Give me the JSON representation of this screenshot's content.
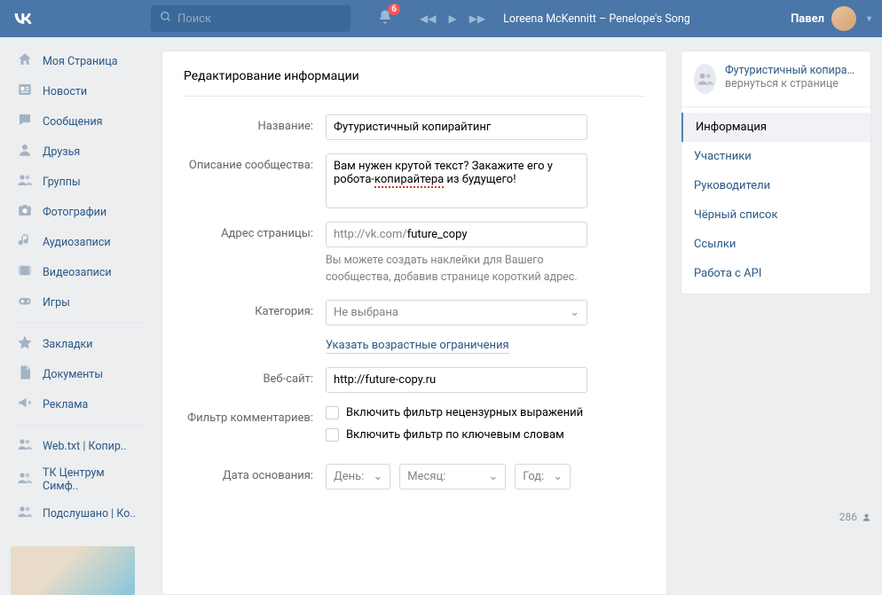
{
  "topbar": {
    "search_placeholder": "Поиск",
    "notification_count": "6",
    "song": "Loreena McKennitt – Penelope's Song",
    "username": "Павел"
  },
  "sidenav": {
    "items": [
      {
        "label": "Моя Страница",
        "icon": "home"
      },
      {
        "label": "Новости",
        "icon": "news"
      },
      {
        "label": "Сообщения",
        "icon": "msg"
      },
      {
        "label": "Друзья",
        "icon": "friend"
      },
      {
        "label": "Группы",
        "icon": "groups"
      },
      {
        "label": "Фотографии",
        "icon": "photo"
      },
      {
        "label": "Аудиозаписи",
        "icon": "audio"
      },
      {
        "label": "Видеозаписи",
        "icon": "video"
      },
      {
        "label": "Игры",
        "icon": "games"
      }
    ],
    "items2": [
      {
        "label": "Закладки",
        "icon": "star"
      },
      {
        "label": "Документы",
        "icon": "docs"
      },
      {
        "label": "Реклама",
        "icon": "ads"
      }
    ],
    "items3": [
      {
        "label": "Web.txt | Копир..",
        "icon": "groups"
      },
      {
        "label": "ТК Центрум Симф..",
        "icon": "groups"
      },
      {
        "label": "Подслушано | Ко..",
        "icon": "groups"
      }
    ]
  },
  "form": {
    "heading": "Редактирование информации",
    "labels": {
      "name": "Название:",
      "desc": "Описание сообщества:",
      "addr": "Адрес страницы:",
      "cat": "Категория:",
      "website": "Веб-сайт:",
      "filter": "Фильтр комментариев:",
      "date": "Дата основания:"
    },
    "name_value": "Футуристичный копирайтинг",
    "desc_value_1": "Вам нужен крутой текст? Закажите его у робота-",
    "desc_value_2": "копирайтера",
    "desc_value_3": " из будущего!",
    "url_prefix": "http://vk.com/",
    "url_value": "future_copy",
    "addr_hint": "Вы можете создать наклейки для Вашего сообщества, добавив странице короткий адрес.",
    "cat_value": "Не выбрана",
    "age_link": "Указать возрастные ограничения",
    "website_value": "http://future-copy.ru",
    "filter1": "Включить фильтр нецензурных выражений",
    "filter2": "Включить фильтр по ключевым словам",
    "date": {
      "day": "День:",
      "month": "Месяц:",
      "year": "Год:"
    }
  },
  "right": {
    "title": "Футуристичный копирай...",
    "sub": "вернуться к странице",
    "tabs": [
      "Информация",
      "Участники",
      "Руководители",
      "Чёрный список",
      "Ссылки",
      "Работа с API"
    ]
  },
  "viewers": "286"
}
